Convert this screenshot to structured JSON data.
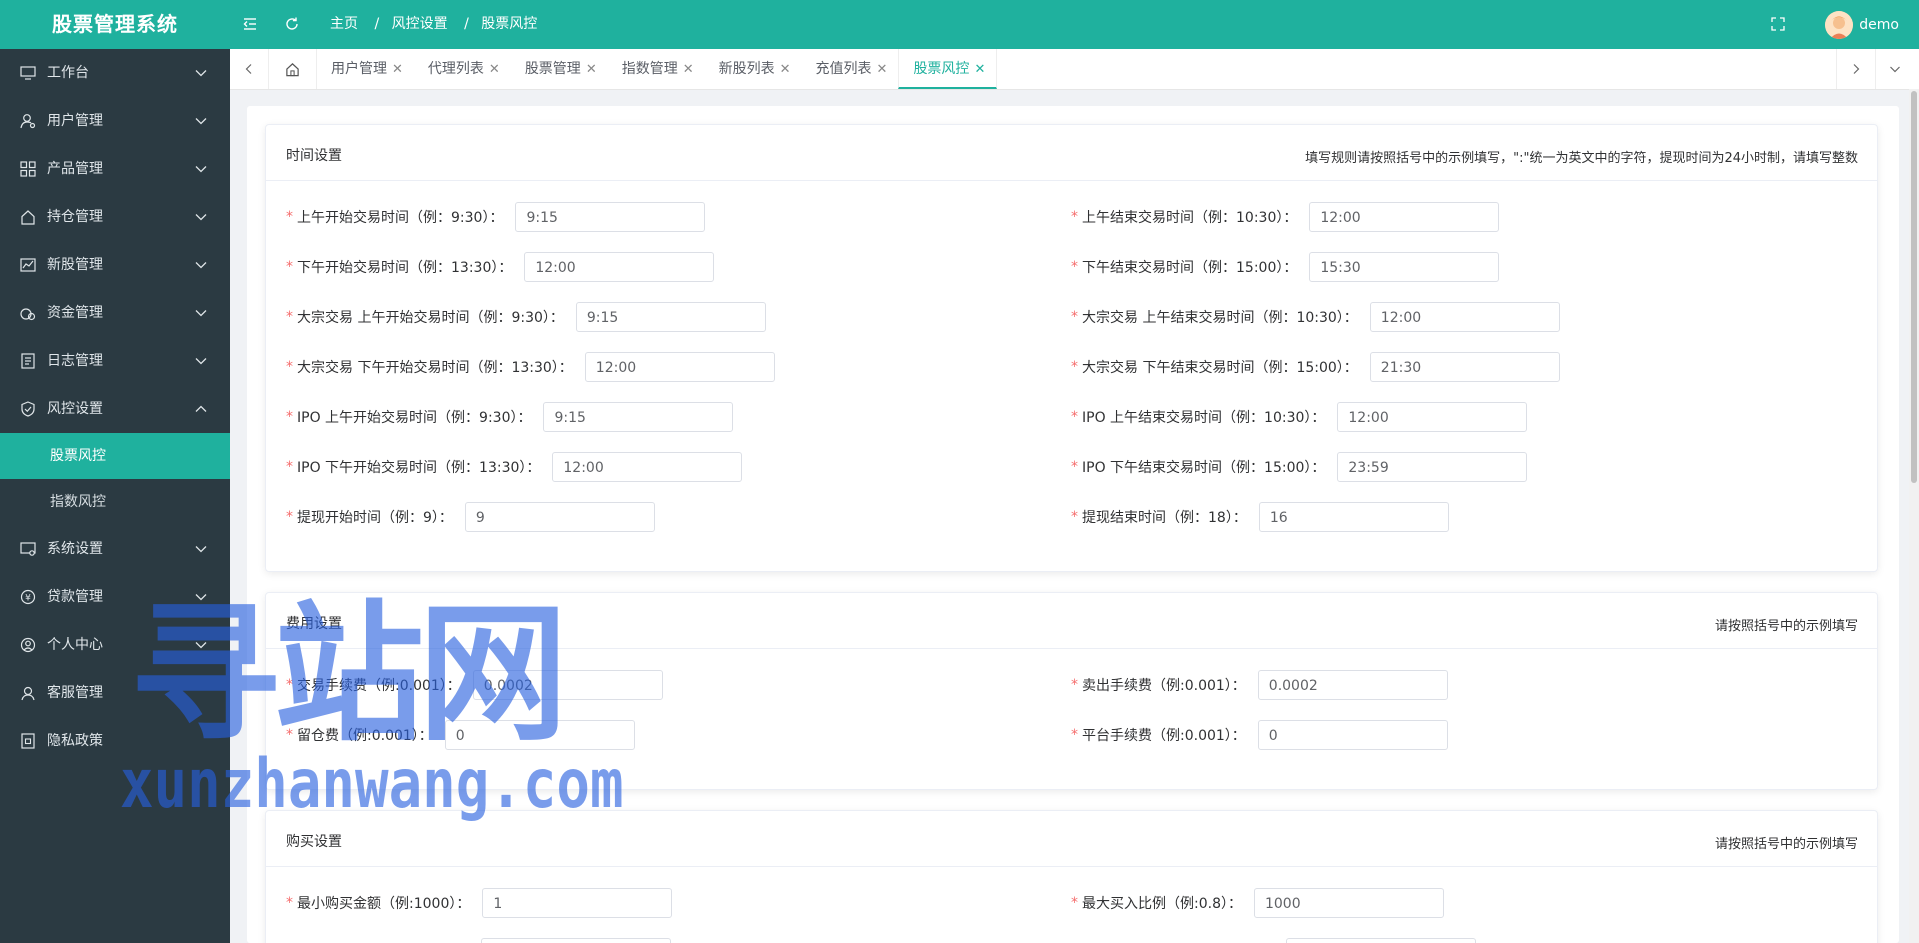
{
  "app": {
    "title": "股票管理系统"
  },
  "breadcrumb": [
    "主页",
    "风控设置",
    "股票风控"
  ],
  "user": {
    "name": "demo"
  },
  "sidebar": {
    "items": [
      {
        "label": "工作台",
        "icon": "monitor-icon",
        "expanded": false
      },
      {
        "label": "用户管理",
        "icon": "user-gear-icon",
        "expanded": false
      },
      {
        "label": "产品管理",
        "icon": "grid-icon",
        "expanded": false
      },
      {
        "label": "持仓管理",
        "icon": "home-icon",
        "expanded": false
      },
      {
        "label": "新股管理",
        "icon": "chart-icon",
        "expanded": false
      },
      {
        "label": "资金管理",
        "icon": "money-icon",
        "expanded": false
      },
      {
        "label": "日志管理",
        "icon": "log-icon",
        "expanded": false
      },
      {
        "label": "风控设置",
        "icon": "shield-icon",
        "expanded": true
      },
      {
        "label": "系统设置",
        "icon": "settings-screen-icon",
        "expanded": false
      },
      {
        "label": "贷款管理",
        "icon": "coin-icon",
        "expanded": false
      },
      {
        "label": "个人中心",
        "icon": "person-icon",
        "expanded": false
      },
      {
        "label": "客服管理",
        "icon": "service-icon",
        "expanded": false
      },
      {
        "label": "隐私政策",
        "icon": "doc-icon",
        "expanded": false
      }
    ],
    "sub_items": [
      {
        "label": "股票风控",
        "active": true
      },
      {
        "label": "指数风控",
        "active": false
      }
    ]
  },
  "tabs": [
    {
      "label": "用户管理",
      "active": false
    },
    {
      "label": "代理列表",
      "active": false
    },
    {
      "label": "股票管理",
      "active": false
    },
    {
      "label": "指数管理",
      "active": false
    },
    {
      "label": "新股列表",
      "active": false
    },
    {
      "label": "充值列表",
      "active": false
    },
    {
      "label": "股票风控",
      "active": true
    }
  ],
  "time_settings": {
    "title": "时间设置",
    "hint": "填写规则请按照括号中的示例填写，\":\"统一为英文中的字符，提现时间为24小时制，请填写整数",
    "fields": [
      {
        "label": "上午开始交易时间（例：9:30）：",
        "value": "9:15"
      },
      {
        "label": "上午结束交易时间（例：10:30）：",
        "value": "12:00"
      },
      {
        "label": "下午开始交易时间（例：13:30）：",
        "value": "12:00"
      },
      {
        "label": "下午结束交易时间（例：15:00）：",
        "value": "15:30"
      },
      {
        "label": "大宗交易 上午开始交易时间（例：9:30）：",
        "value": "9:15"
      },
      {
        "label": "大宗交易 上午结束交易时间（例：10:30）：",
        "value": "12:00"
      },
      {
        "label": "大宗交易 下午开始交易时间（例：13:30）：",
        "value": "12:00"
      },
      {
        "label": "大宗交易 下午结束交易时间（例：15:00）：",
        "value": "21:30"
      },
      {
        "label": "IPO 上午开始交易时间（例：9:30）：",
        "value": "9:15"
      },
      {
        "label": "IPO 上午结束交易时间（例：10:30）：",
        "value": "12:00"
      },
      {
        "label": "IPO 下午开始交易时间（例：13:30）：",
        "value": "12:00"
      },
      {
        "label": "IPO 下午结束交易时间（例：15:00）：",
        "value": "23:59"
      },
      {
        "label": "提现开始时间（例：9）：",
        "value": "9"
      },
      {
        "label": "提现结束时间（例：18）：",
        "value": "16"
      }
    ]
  },
  "fee_settings": {
    "title": "费用设置",
    "hint": "请按照括号中的示例填写",
    "fields": [
      {
        "label": "交易手续费（例:0.001）：",
        "value": "0.0002"
      },
      {
        "label": "卖出手续费（例:0.001）：",
        "value": "0.0002"
      },
      {
        "label": "留仓费（例:0.001）：",
        "value": "0"
      },
      {
        "label": "平台手续费（例:0.001）：",
        "value": "0"
      }
    ]
  },
  "buy_settings": {
    "title": "购买设置",
    "hint": "请按照括号中的示例填写",
    "fields": [
      {
        "label": "最小购买金额（例:1000）：",
        "value": "1"
      },
      {
        "label": "最大买入比例（例:0.8）：",
        "value": "1000"
      }
    ]
  },
  "watermark": {
    "line1": "寻站网",
    "line2": "xunzhanwang.com"
  },
  "colors": {
    "accent": "#1fb19e",
    "sidebar": "#2b3a42",
    "required": "#f56c6c"
  }
}
